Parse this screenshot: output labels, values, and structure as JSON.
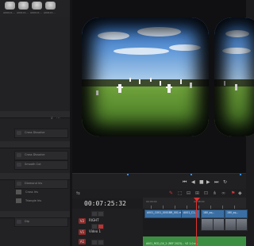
{
  "media_pool": {
    "thumbs": [
      "A001C1...",
      "A001C1...",
      "A001C1...",
      "A001C1..."
    ]
  },
  "effects": {
    "group1": [
      "Cross Dissolve"
    ],
    "group2": [
      "Cross Dissolve",
      "Smooth Cut"
    ],
    "group3": [
      "Diamond Iris",
      "Cross Iris",
      "Triangle Iris"
    ],
    "group4": [
      "Dip"
    ]
  },
  "timeline": {
    "timecode": "00:07:25:32",
    "ruler": [
      "00:00:00",
      "00:08:00"
    ],
    "tracks": [
      {
        "tag": "V2",
        "name": "RIGHT",
        "color": "#8a2a2a"
      },
      {
        "tag": "V1",
        "name": "Video 1",
        "color": "#8a2a2a"
      },
      {
        "tag": "A1",
        "name": "",
        "color": "#8a2a2a"
      }
    ],
    "clips": [
      "A001_C001_0001BR_001.mov",
      "A001_C1...",
      "180_sq...",
      "180_sq..."
    ],
    "audio_clip": "A001_RCD_GX_2 (REF 2023)... V2 1.0 e..."
  },
  "colors": {
    "accent": "#3a8ee6",
    "playhead": "#e0312f",
    "clip": "#3b6fa3",
    "audio": "#3c8f42"
  }
}
